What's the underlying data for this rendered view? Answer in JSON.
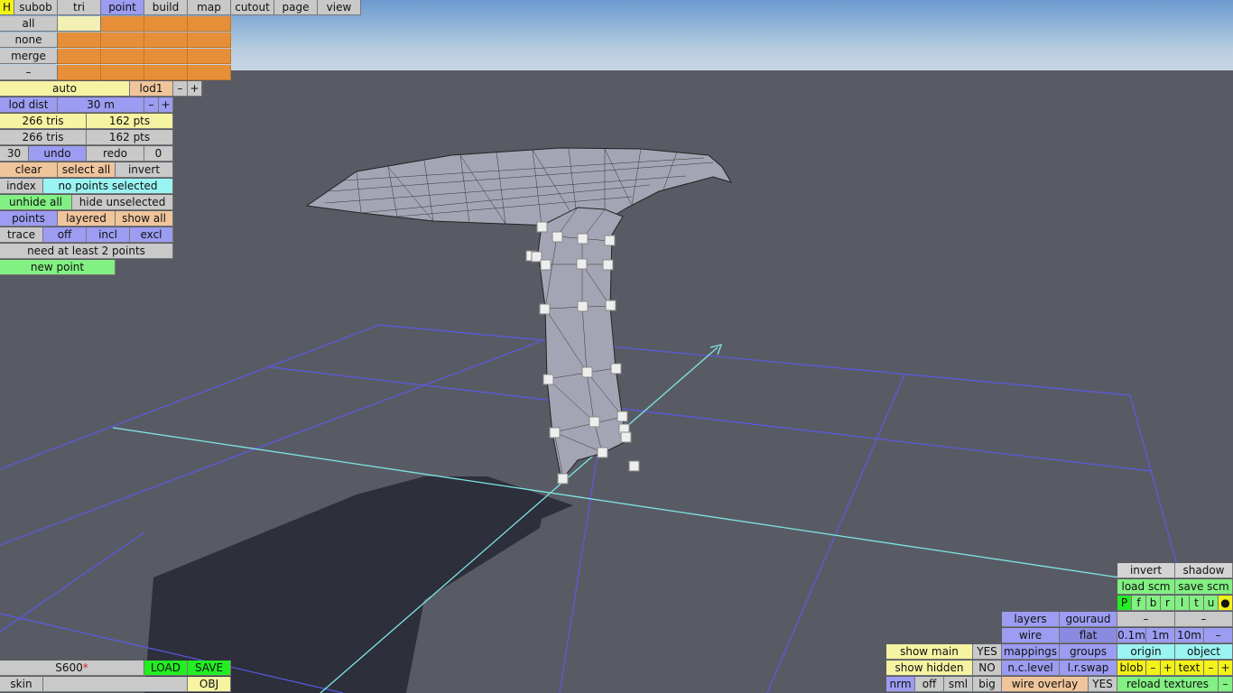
{
  "menu": {
    "h": "H",
    "tabs": [
      "subob",
      "tri",
      "point",
      "build",
      "map",
      "cutout",
      "page",
      "view"
    ],
    "active_tab": "point"
  },
  "selection_rows": [
    "all",
    "none",
    "merge",
    "–"
  ],
  "lod": {
    "mode": "auto",
    "level": "lod1",
    "minus": "–",
    "plus": "+",
    "dist_label": "lod dist",
    "dist_value": "30 m"
  },
  "stats": [
    {
      "tris": "266 tris",
      "pts": "162 pts"
    },
    {
      "tris": "266 tris",
      "pts": "162 pts"
    }
  ],
  "history": {
    "count": "30",
    "undo": "undo",
    "redo": "redo",
    "redo_count": "0"
  },
  "select_row": {
    "clear": "clear",
    "select_all": "select all",
    "invert": "invert"
  },
  "index": {
    "label": "index",
    "status": "no points selected"
  },
  "hide_row": {
    "unhide_all": "unhide all",
    "hide_unselected": "hide unselected"
  },
  "points_row": {
    "points": "points",
    "layered": "layered",
    "show_all": "show all"
  },
  "trace_row": {
    "trace": "trace",
    "off": "off",
    "incl": "incl",
    "excl": "excl"
  },
  "message": "need at least 2 points",
  "new_point": "new point",
  "file": {
    "name": "S600",
    "modified_mark": "*",
    "load": "LOAD",
    "save": "SAVE",
    "skin_label": "skin",
    "skin_value": "",
    "obj": "OBJ"
  },
  "right_panel": {
    "invert": "invert",
    "shadow": "shadow",
    "load_scm": "load scm",
    "save_scm": "save scm",
    "views": [
      "P",
      "f",
      "b",
      "r",
      "l",
      "t",
      "u",
      "●"
    ],
    "layers": "layers",
    "gouraud": "gouraud",
    "dash1": "–",
    "dash2": "–",
    "wire": "wire",
    "flat": "flat",
    "steps": [
      "0.1m",
      "1m",
      "10m",
      "–"
    ],
    "mappings": "mappings",
    "groups": "groups",
    "origin": "origin",
    "object": "object",
    "nc_level": "n.c.level",
    "lr_swap": "l.r.swap",
    "blob": "blob",
    "text": "text",
    "minus": "–",
    "plus": "+",
    "wire_overlay": "wire overlay",
    "wire_overlay_value": "YES",
    "reload_textures": "reload textures",
    "reload_minus": "–"
  },
  "show_panel": {
    "show_main": "show main",
    "show_main_value": "YES",
    "show_hidden": "show hidden",
    "show_hidden_value": "NO",
    "sizes": [
      "nrm",
      "off",
      "sml",
      "big"
    ]
  },
  "colors": {
    "sky_top": "#6b9bd0",
    "ground": "#595b64",
    "grid": "#5a5ae6",
    "axis": "#7de6e6",
    "mesh": "#a4a5b4"
  }
}
